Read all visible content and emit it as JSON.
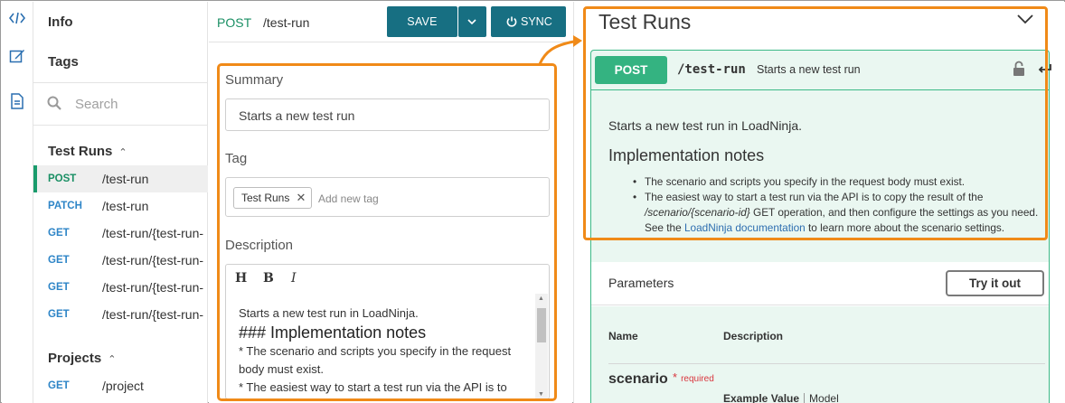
{
  "rail": {
    "icons": [
      "code-icon",
      "edit-icon",
      "document-icon"
    ]
  },
  "nav": {
    "info": "Info",
    "tags": "Tags",
    "search_placeholder": "Search",
    "groups": [
      {
        "title": "Test Runs",
        "caret": "^",
        "ops": [
          {
            "method": "POST",
            "path": "/test-run"
          },
          {
            "method": "PATCH",
            "path": "/test-run"
          },
          {
            "method": "GET",
            "path": "/test-run/{test-run-"
          },
          {
            "method": "GET",
            "path": "/test-run/{test-run-"
          },
          {
            "method": "GET",
            "path": "/test-run/{test-run-"
          },
          {
            "method": "GET",
            "path": "/test-run/{test-run-"
          }
        ]
      },
      {
        "title": "Projects",
        "caret": "^",
        "ops": [
          {
            "method": "GET",
            "path": "/project"
          }
        ]
      }
    ]
  },
  "editor": {
    "method": "POST",
    "path": "/test-run",
    "save_label": "SAVE",
    "sync_label": "SYNC",
    "summary_label": "Summary",
    "summary_value": "Starts a new test run",
    "tag_label": "Tag",
    "tag_chip": "Test Runs",
    "tag_chip_remove": "✕",
    "add_tag_placeholder": "Add new tag",
    "description_label": "Description",
    "toolbar": {
      "h": "H",
      "b": "B",
      "i": "I"
    },
    "description_lines": {
      "l1": "Starts a new test run in LoadNinja.",
      "l2": "### Implementation notes",
      "l3": "* The scenario and scripts you specify in the request",
      "l4": "body must exist.",
      "l5": "* The easiest way to start a test run via the API is to"
    }
  },
  "docs": {
    "title": "Test Runs",
    "op": {
      "method": "POST",
      "path": "/test-run",
      "summary": "Starts a new test run",
      "description": "Starts a new test run in LoadNinja.",
      "impl_heading": "Implementation notes",
      "bullet1": "The scenario and scripts you specify in the request body must exist.",
      "bullet2_a": "The easiest way to start a test run via the API is to copy the result of the",
      "bullet2_italic": "/scenario/{scenario-id}",
      "bullet2_b": "GET operation, and then configure the settings as you need.",
      "bullet2_c": "See the",
      "bullet2_link": "LoadNinja documentation",
      "bullet2_d": "to learn more about the scenario settings."
    },
    "parameters": {
      "title": "Parameters",
      "try_label": "Try it out",
      "col_name": "Name",
      "col_desc": "Description",
      "param_name": "scenario",
      "required_star": "*",
      "required_label": "required",
      "example_value": "Example Value",
      "model": "Model"
    }
  },
  "colors": {
    "post": "#34b381",
    "get": "#2e85c7",
    "primary_button": "#176f82",
    "highlight": "#f08a18",
    "op_background": "#eaf7f1"
  }
}
